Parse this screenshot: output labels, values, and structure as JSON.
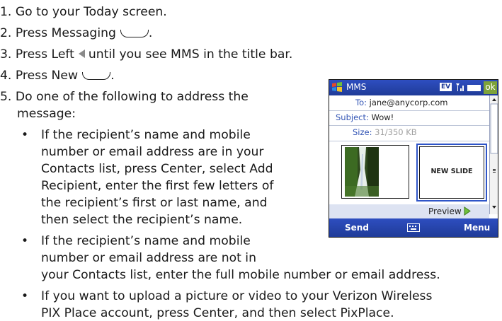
{
  "steps": [
    "1. Go to your Today screen.",
    "2. Press Messaging",
    "3. Press Left",
    "until you see MMS in the title bar.",
    "4. Press New",
    "5. Do one of the following to address the",
    "message:"
  ],
  "period": ".",
  "bullet1": [
    "If the recipient’s name and mobile",
    "number or email address are in your",
    "Contacts list, press Center, select Add",
    "Recipient, enter the first few letters of",
    "the recipient’s first or last name, and",
    "then select the recipient’s name."
  ],
  "bullet2": [
    "If the recipient’s name and mobile",
    "number or email address are not in",
    "your Contacts list, enter the full mobile number or email address."
  ],
  "bullet3": [
    "If you want to upload a picture or video to your Verizon Wireless",
    "PIX Place account, press Center, and then select PixPlace."
  ],
  "bullet_char": "•",
  "phone": {
    "title": "MMS",
    "status_ev": "EV",
    "ok": "ok",
    "to_label": "To:",
    "to_value": "jane@anycorp.com",
    "subject_label": "Subject:",
    "subject_value": "Wow!",
    "size_label": "Size:",
    "size_value": "31/350 KB",
    "new_slide": "NEW SLIDE",
    "preview": "Preview",
    "send": "Send",
    "menu": "Menu",
    "colors": {
      "titlebar": "#1f3b98",
      "ok": "#7ea33a",
      "label": "#3355b5"
    }
  }
}
